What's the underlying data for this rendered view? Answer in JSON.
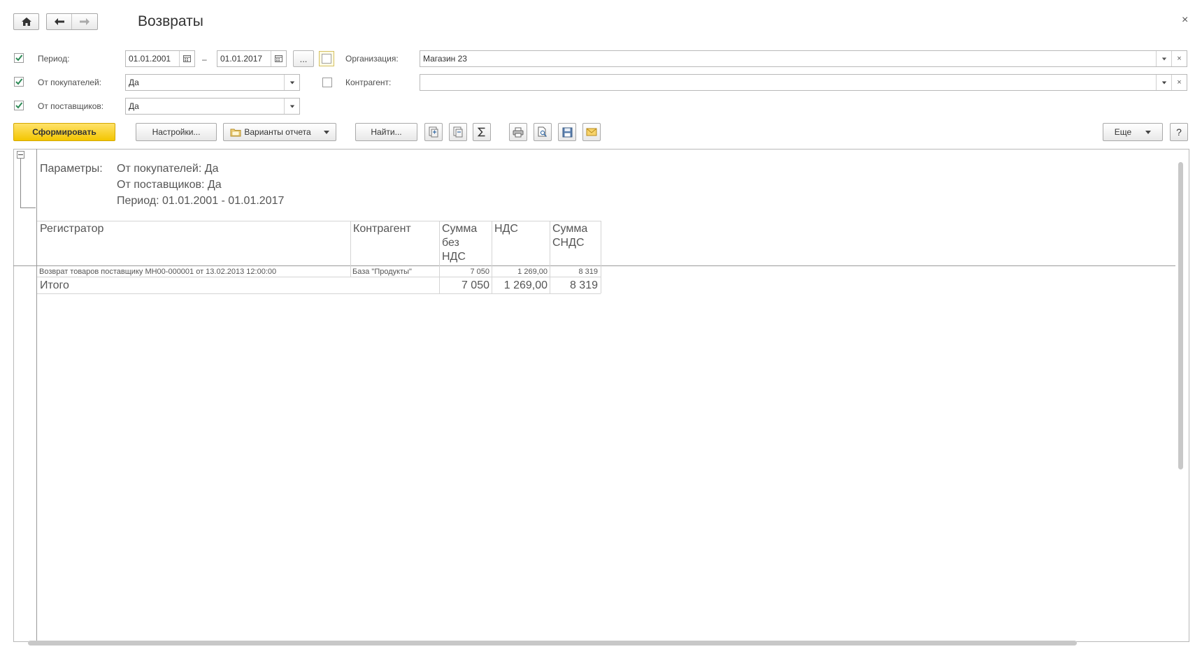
{
  "window": {
    "title": "Возвраты",
    "close": "×"
  },
  "filters": {
    "period": {
      "label": "Период:",
      "from": "01.01.2001",
      "to": "01.01.2017",
      "dash": "–",
      "dots": "..."
    },
    "from_buyers": {
      "label": "От покупателей:",
      "value": "Да"
    },
    "from_suppliers": {
      "label": "От поставщиков:",
      "value": "Да"
    },
    "organization": {
      "label": "Организация:",
      "value": "Магазин 23"
    },
    "counterparty": {
      "label": "Контрагент:",
      "value": ""
    }
  },
  "toolbar": {
    "generate": "Сформировать",
    "settings": "Настройки...",
    "variants": "Варианты отчета",
    "find": "Найти...",
    "more": "Еще",
    "help": "?"
  },
  "report": {
    "params_label": "Параметры:",
    "params": [
      "От покупателей: Да",
      "От поставщиков: Да",
      "Период: 01.01.2001 - 01.01.2017"
    ],
    "columns": {
      "registrar": "Регистратор",
      "counterparty": "Контрагент",
      "sum_no_vat": [
        "Сумма",
        "без",
        "НДС"
      ],
      "vat": "НДС",
      "sum_with_vat": [
        "Сумма",
        "СНДС"
      ]
    },
    "rows": [
      {
        "registrar": "Возврат товаров поставщику МН00-000001 от 13.02.2013 12:00:00",
        "counterparty": "База \"Продукты\"",
        "sum_no_vat": "7 050",
        "vat": "1 269,00",
        "sum_with_vat": "8 319"
      }
    ],
    "total": {
      "label": "Итого",
      "sum_no_vat": "7 050",
      "vat": "1 269,00",
      "sum_with_vat": "8 319"
    }
  },
  "colors": {
    "primary_button": "#f3c600",
    "check": "#2e8b57"
  }
}
